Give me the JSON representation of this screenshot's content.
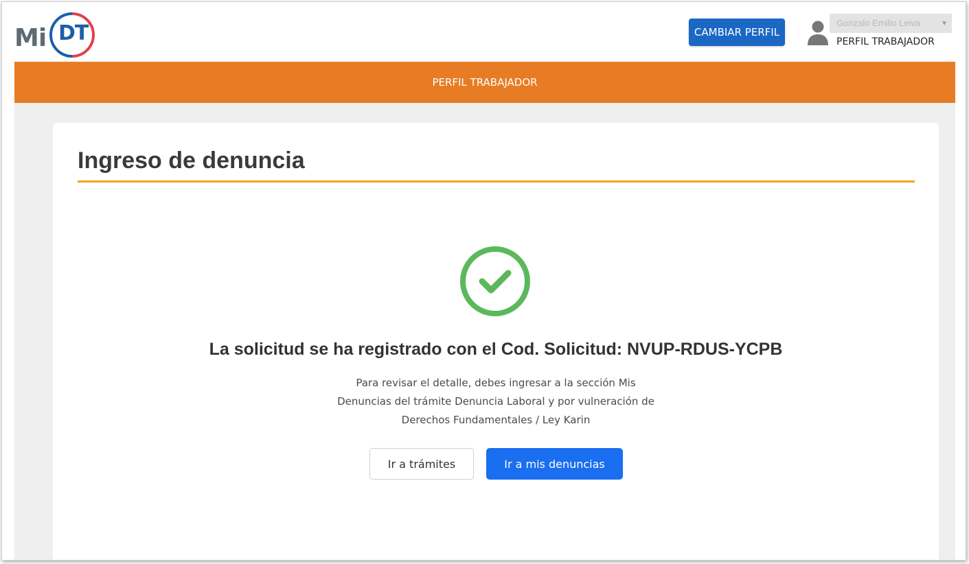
{
  "header": {
    "logo": {
      "text_mi": "Mi",
      "text_dt": "DT",
      "ring_colors": [
        "#1b5fa8",
        "#e2404a"
      ]
    },
    "change_profile_label": "CAMBIAR PERFIL",
    "user": {
      "name": "Gonzalo Emilio Leiva",
      "profile": "PERFIL TRABAJADOR",
      "icon": "user-icon"
    }
  },
  "banner": {
    "label": "PERFIL TRABAJADOR"
  },
  "main": {
    "title": "Ingreso de denuncia",
    "success_icon": "check-circle-icon",
    "success_message": "La solicitud se ha registrado con el Cod. Solicitud: NVUP-RDUS-YCPB",
    "detail_lines": [
      "Para revisar el detalle, debes ingresar a la sección Mis",
      "Denuncias del trámite Denuncia Laboral y por vulneración de",
      "Derechos Fundamentales / Ley Karin"
    ],
    "buttons": {
      "tramites": "Ir a trámites",
      "denuncias": "Ir a mis denuncias"
    }
  },
  "colors": {
    "banner": "#e87c25",
    "title_rule": "#f2a31b",
    "primary": "#1a6ef0",
    "change_profile": "#1b67c4",
    "success": "#5cb85c"
  }
}
